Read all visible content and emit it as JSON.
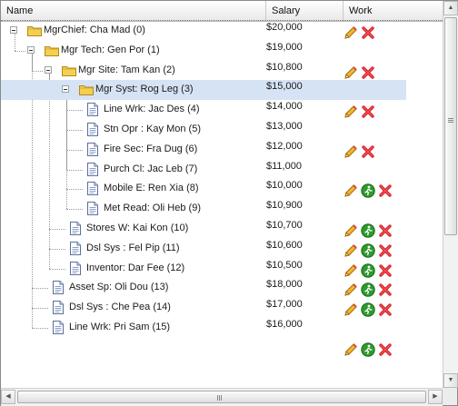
{
  "columns": {
    "name": "Name",
    "salary": "Salary",
    "work": "Work"
  },
  "rows": [
    {
      "label": "MgrChief: Cha Mad (0)",
      "salary": "$20,000",
      "depth": 0,
      "type": "folder",
      "actions": [
        "edit",
        "delete"
      ],
      "selected": false
    },
    {
      "label": "Mgr Tech: Gen Por (1)",
      "salary": "$19,000",
      "depth": 1,
      "type": "folder",
      "actions": [],
      "selected": false
    },
    {
      "label": "Mgr Site: Tam Kan (2)",
      "salary": "$10,800",
      "depth": 2,
      "type": "folder",
      "actions": [
        "edit",
        "delete"
      ],
      "selected": false
    },
    {
      "label": "Mgr Syst: Rog Leg (3)",
      "salary": "$15,000",
      "depth": 3,
      "type": "folder",
      "actions": [],
      "selected": true
    },
    {
      "label": "Line Wrk: Jac Des (4)",
      "salary": "$14,000",
      "depth": 4,
      "type": "doc",
      "actions": [
        "edit",
        "delete"
      ],
      "selected": false
    },
    {
      "label": "Stn Opr : Kay Mon (5)",
      "salary": "$13,000",
      "depth": 4,
      "type": "doc",
      "actions": [],
      "selected": false
    },
    {
      "label": "Fire Sec: Fra Dug (6)",
      "salary": "$12,000",
      "depth": 4,
      "type": "doc",
      "actions": [
        "edit",
        "delete"
      ],
      "selected": false
    },
    {
      "label": "Purch Cl: Jac Leb (7)",
      "salary": "$11,000",
      "depth": 4,
      "type": "doc",
      "actions": [],
      "selected": false
    },
    {
      "label": "Mobile E: Ren Xia (8)",
      "salary": "$10,000",
      "depth": 4,
      "type": "doc",
      "actions": [
        "edit",
        "run",
        "delete"
      ],
      "selected": false
    },
    {
      "label": "Met Read: Oli Heb (9)",
      "salary": "$10,900",
      "depth": 4,
      "type": "doc",
      "actions": [],
      "selected": false
    },
    {
      "label": "Stores W: Kai Kon (10)",
      "salary": "$10,700",
      "depth": 3,
      "type": "doc",
      "actions": [
        "edit",
        "run",
        "delete"
      ],
      "selected": false
    },
    {
      "label": "Dsl Sys : Fel Pip (11)",
      "salary": "$10,600",
      "depth": 3,
      "type": "doc",
      "actions": [
        "edit",
        "run",
        "delete"
      ],
      "selected": false
    },
    {
      "label": "Inventor: Dar Fee (12)",
      "salary": "$10,500",
      "depth": 3,
      "type": "doc",
      "actions": [
        "edit",
        "run",
        "delete"
      ],
      "selected": false
    },
    {
      "label": "Asset Sp: Oli Dou (13)",
      "salary": "$18,000",
      "depth": 2,
      "type": "doc",
      "actions": [
        "edit",
        "run",
        "delete"
      ],
      "selected": false
    },
    {
      "label": "Dsl Sys : Che Pea (14)",
      "salary": "$17,000",
      "depth": 2,
      "type": "doc",
      "actions": [
        "edit",
        "run",
        "delete"
      ],
      "selected": false
    },
    {
      "label": "Line Wrk: Pri Sam (15)",
      "salary": "$16,000",
      "depth": 2,
      "type": "doc",
      "actions": [],
      "selected": false
    },
    {
      "label": "",
      "salary": "",
      "depth": 2,
      "type": "none",
      "actions": [
        "edit",
        "run",
        "delete"
      ],
      "selected": false
    }
  ],
  "icons": {
    "expand_collapse": "minus-box-icon",
    "folder": "folder-icon",
    "document": "document-icon",
    "edit": "pencil-icon",
    "run": "run-icon",
    "delete": "delete-icon"
  },
  "colors": {
    "selection": "#d6e3f5",
    "folder": "#f2c94c",
    "delete": "#d8232a",
    "run": "#2e9a2e"
  }
}
